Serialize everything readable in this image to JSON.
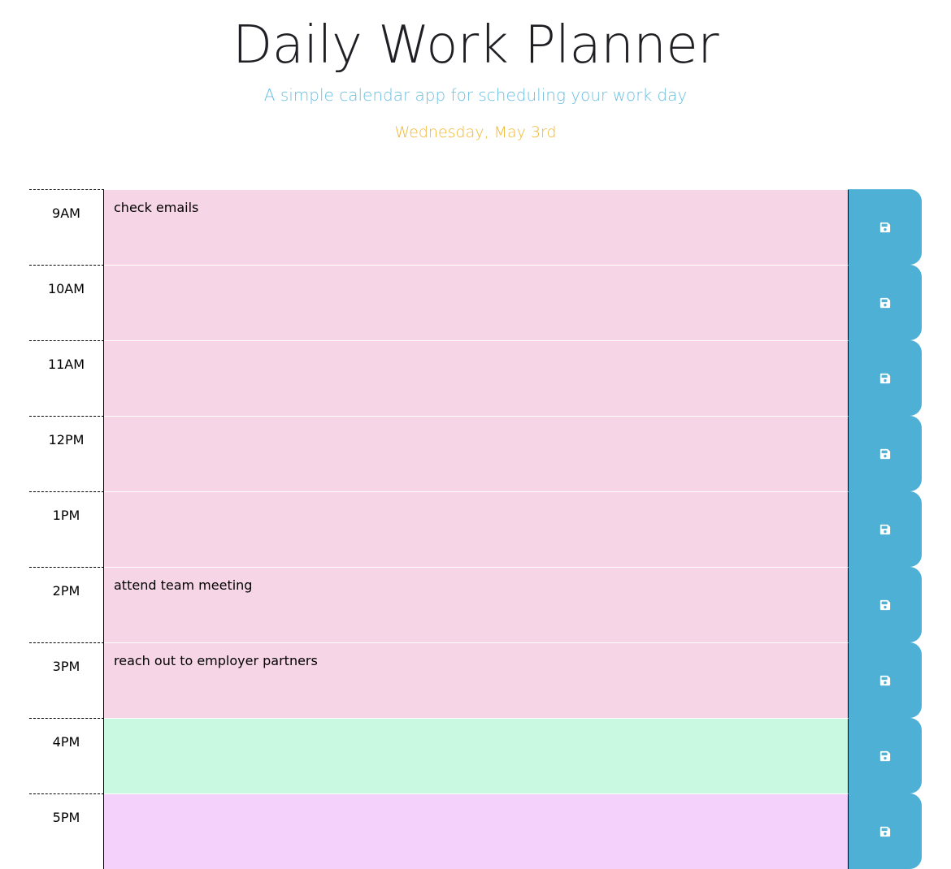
{
  "header": {
    "title": "Daily Work Planner",
    "subtitle": "A simple calendar app for scheduling your work day",
    "current_date": "Wednesday, May 3rd"
  },
  "colors": {
    "past": "#f6d6e6",
    "present": "#caf9e1",
    "future": "#f4d1fb",
    "save_button": "#4fb0d6",
    "subtitle": "#6cbfe0",
    "date": "#f0b733"
  },
  "timeblocks": [
    {
      "hour": "9AM",
      "text": "check emails",
      "state": "past",
      "save_icon": "save-icon"
    },
    {
      "hour": "10AM",
      "text": "",
      "state": "past",
      "save_icon": "save-icon"
    },
    {
      "hour": "11AM",
      "text": "",
      "state": "past",
      "save_icon": "save-icon"
    },
    {
      "hour": "12PM",
      "text": "",
      "state": "past",
      "save_icon": "save-icon"
    },
    {
      "hour": "1PM",
      "text": "",
      "state": "past",
      "save_icon": "save-icon"
    },
    {
      "hour": "2PM",
      "text": "attend team meeting",
      "state": "past",
      "save_icon": "save-icon"
    },
    {
      "hour": "3PM",
      "text": "reach out to employer partners",
      "state": "past",
      "save_icon": "save-icon"
    },
    {
      "hour": "4PM",
      "text": "",
      "state": "present",
      "save_icon": "save-icon"
    },
    {
      "hour": "5PM",
      "text": "",
      "state": "future",
      "save_icon": "save-icon"
    }
  ]
}
